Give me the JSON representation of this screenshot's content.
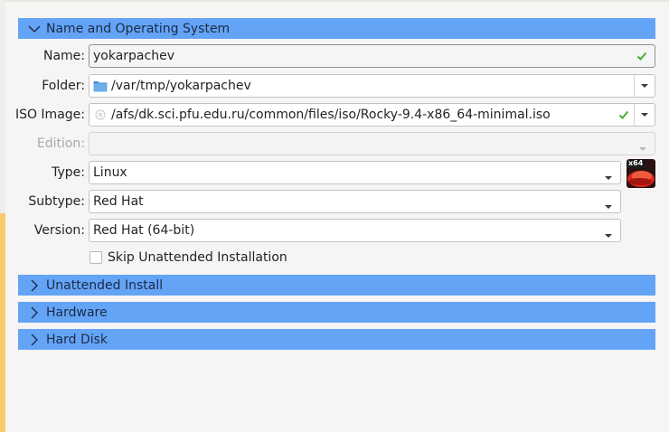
{
  "sections": {
    "name_os": "Name and Operating System",
    "unattended": "Unattended Install",
    "hardware": "Hardware",
    "hard_disk": "Hard Disk"
  },
  "labels": {
    "name": "Name:",
    "folder": "Folder:",
    "iso_image": "ISO Image:",
    "edition": "Edition:",
    "type": "Type:",
    "subtype": "Subtype:",
    "version": "Version:"
  },
  "values": {
    "name": "yokarpachev",
    "folder": "/var/tmp/yokarpachev",
    "iso_image": "/afs/dk.sci.pfu.edu.ru/common/files/iso/Rocky-9.4-x86_64-minimal.iso",
    "edition": "",
    "type": "Linux",
    "subtype": "Red Hat",
    "version": "Red Hat (64-bit)"
  },
  "skip_unattended": {
    "label": "Skip Unattended Installation",
    "checked": false
  },
  "os_icon": {
    "name": "redhat-x64-icon",
    "badge": "x64"
  },
  "colors": {
    "header_bg": "#64a4f7",
    "valid_check": "#4caf2a"
  }
}
